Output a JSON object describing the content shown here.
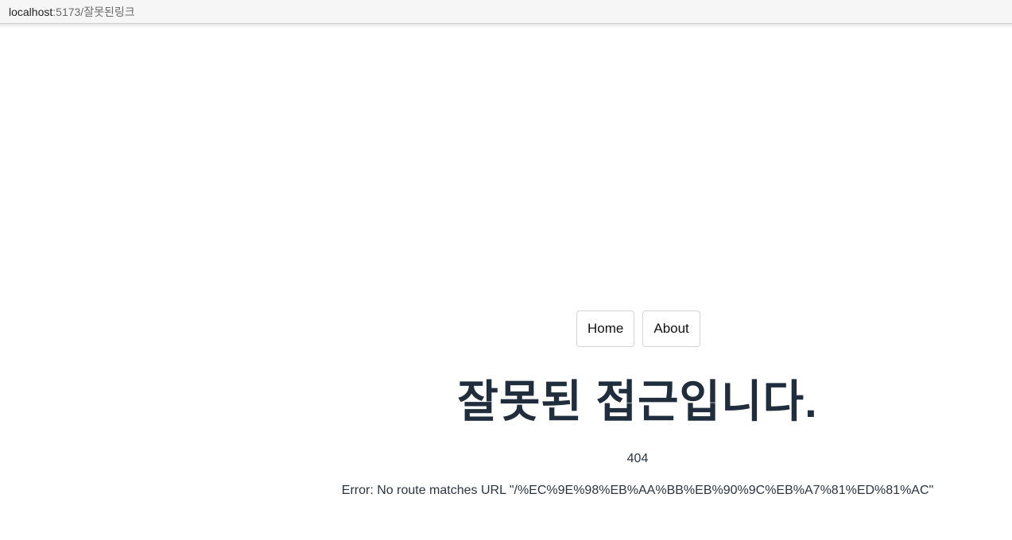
{
  "browser": {
    "url_host": "localhost",
    "url_path": ":5173/잘못된링크"
  },
  "nav": {
    "home_label": "Home",
    "about_label": "About"
  },
  "main": {
    "title": "잘못된 접근입니다.",
    "status_code": "404",
    "error_message": "Error: No route matches URL \"/%EC%9E%98%EB%AA%BB%EB%90%9C%EB%A7%81%ED%81%AC\""
  },
  "colors": {
    "title": "#1f2d3d",
    "text": "#2b3440",
    "address_bar_bg": "#f6f6f6",
    "button_border": "#d4d4d4"
  }
}
